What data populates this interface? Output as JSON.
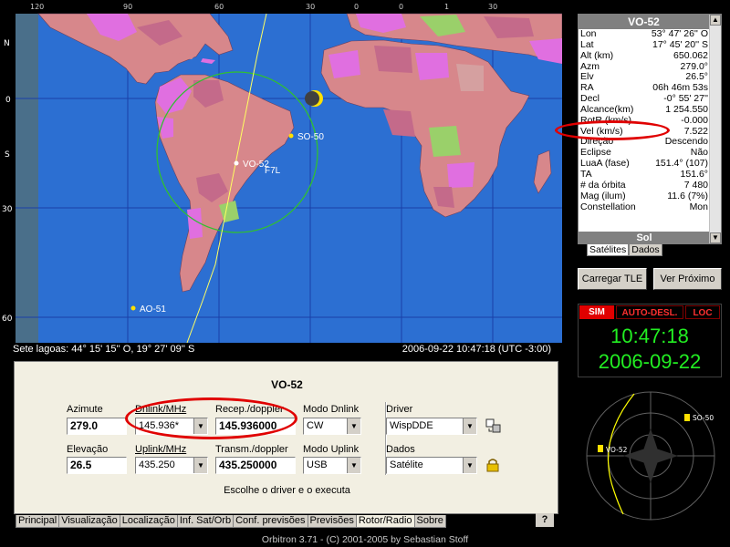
{
  "map": {
    "top_longitudes": [
      "120",
      "90",
      "60",
      "30",
      "0",
      "30",
      "0",
      "30"
    ],
    "top_longitudes_b": [
      "0",
      "1"
    ],
    "left_latitudes": [
      "N",
      "0",
      "S",
      "30",
      "60"
    ],
    "satellites": {
      "vo52": "VO-52",
      "so50": "SO-50",
      "ao51": "AO-51"
    },
    "observer_label": "F7L"
  },
  "status_bar": {
    "location": "Sete lagoas: 44° 15' 15'' O, 19° 27' 09'' S",
    "datetime": "2006-09-22 10:47:18 (UTC -3:00)"
  },
  "info": {
    "title": "VO-52",
    "rows": [
      {
        "k": "Lon",
        "v": "53° 47' 26'' O"
      },
      {
        "k": "Lat",
        "v": "17° 45' 20'' S"
      },
      {
        "k": "Alt (km)",
        "v": "650.062"
      },
      {
        "k": "Azm",
        "v": "279.0°"
      },
      {
        "k": "Elv",
        "v": "26.5°"
      },
      {
        "k": "RA",
        "v": "06h 46m 53s"
      },
      {
        "k": "Decl",
        "v": "-0° 55' 27''"
      },
      {
        "k": "Alcance(km)",
        "v": "1 254.550"
      },
      {
        "k": "RotR (km/s)",
        "v": "-0.000"
      },
      {
        "k": "Vel (km/s)",
        "v": "7.522"
      },
      {
        "k": "Direção",
        "v": "Descendo"
      },
      {
        "k": "Eclipse",
        "v": "Não"
      },
      {
        "k": "LuaA (fase)",
        "v": "151.4° (107)"
      },
      {
        "k": "TA",
        "v": "151.6°"
      },
      {
        "k": "# da órbita",
        "v": "7 480"
      },
      {
        "k": "Mag (ilum)",
        "v": "11.6 (7%)"
      },
      {
        "k": "Constellation",
        "v": "Mon"
      }
    ],
    "sun_header": "Sol",
    "tabs": [
      "Satélites",
      "Dados"
    ]
  },
  "buttons": {
    "load_tle": "Carregar TLE",
    "next": "Ver Próximo"
  },
  "clock": {
    "sim": "SIM",
    "auto": "AUTO-DESL.",
    "loc": "LOC",
    "time": "10:47:18",
    "date": "2006-09-22"
  },
  "radar": {
    "sat_a": "VO-52",
    "sat_b": "SO-50"
  },
  "rotor": {
    "title": "VO-52",
    "azimuth_label": "Azimute",
    "azimuth_value": "279.0",
    "elevation_label": "Elevação",
    "elevation_value": "26.5",
    "dnlink_label": "Dnlink/MHz",
    "dnlink_value": "145.936*",
    "uplink_label": "Uplink/MHz",
    "uplink_value": "435.250",
    "recep_label": "Recep./doppler",
    "recep_value": "145.936000",
    "transm_label": "Transm./doppler",
    "transm_value": "435.250000",
    "mode_dn_label": "Modo Dnlink",
    "mode_dn_value": "CW",
    "mode_up_label": "Modo Uplink",
    "mode_up_value": "USB",
    "driver_label": "Driver",
    "driver_value": "WispDDE",
    "data_label": "Dados",
    "data_value": "Satélite",
    "hint": "Escolhe o driver e o executa"
  },
  "main_tabs": [
    "Principal",
    "Visualização",
    "Localização",
    "Inf. Sat/Orb",
    "Conf. previsões",
    "Previsões",
    "Rotor/Radio",
    "Sobre"
  ],
  "help_tab": "?",
  "footer": "Orbitron 3.71 - (C) 2001-2005 by Sebastian Stoff",
  "colors": {
    "ocean": "#2c6fd2",
    "land": "#d7878b",
    "grid": "#1a3fa8",
    "clock_green": "#22ee22",
    "annotation": "#e00000"
  }
}
